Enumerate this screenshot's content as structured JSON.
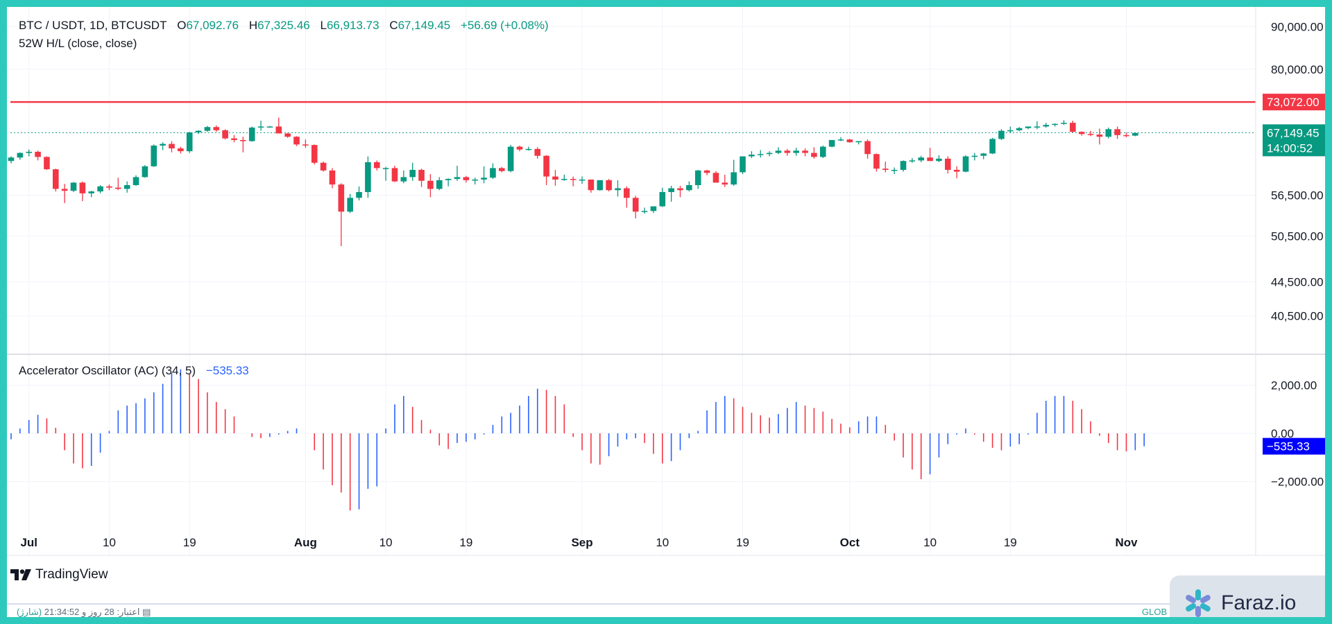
{
  "legend": {
    "symbol": "BTC / USDT, 1D, BTCUSDT",
    "o_label": "O",
    "o_value": "67,092.76",
    "h_label": "H",
    "h_value": "67,325.46",
    "l_label": "L",
    "l_value": "66,913.73",
    "c_label": "C",
    "c_value": "67,149.45",
    "change": "+56.69 (+0.08%)",
    "indicator": "52W H/L (close, close)",
    "oscillator": "Accelerator Oscillator (AC) (34, 5)",
    "oscillator_value": "−535.33"
  },
  "price_axis": {
    "ticks": [
      {
        "value": 90000,
        "label": "90,000.00"
      },
      {
        "value": 80000,
        "label": "80,000.00"
      },
      {
        "value": 56500,
        "label": "56,500.00"
      },
      {
        "value": 50500,
        "label": "50,500.00"
      },
      {
        "value": 44500,
        "label": "44,500.00"
      },
      {
        "value": 40500,
        "label": "40,500.00"
      }
    ],
    "high_line": {
      "value": 73072,
      "label": "73,072.00",
      "color": "#f23645"
    },
    "last_price": {
      "value": 67149.45,
      "label": "67,149.45",
      "countdown": "14:00:52",
      "color": "#089981"
    }
  },
  "osc_axis": {
    "ticks": [
      {
        "value": 2000,
        "label": "2,000.00"
      },
      {
        "value": 0,
        "label": "0.00"
      },
      {
        "value": -2000,
        "label": "−2,000.00"
      }
    ],
    "last": {
      "value": -535.33,
      "label": "−535.33",
      "color": "#0000ff"
    }
  },
  "time_axis": [
    {
      "label": "Jul",
      "bold": true,
      "index": 2
    },
    {
      "label": "10",
      "bold": false,
      "index": 11
    },
    {
      "label": "19",
      "bold": false,
      "index": 20
    },
    {
      "label": "Aug",
      "bold": true,
      "index": 33
    },
    {
      "label": "10",
      "bold": false,
      "index": 42
    },
    {
      "label": "19",
      "bold": false,
      "index": 51
    },
    {
      "label": "Sep",
      "bold": true,
      "index": 64
    },
    {
      "label": "10",
      "bold": false,
      "index": 73
    },
    {
      "label": "19",
      "bold": false,
      "index": 82
    },
    {
      "label": "Oct",
      "bold": true,
      "index": 94
    },
    {
      "label": "10",
      "bold": false,
      "index": 103
    },
    {
      "label": "19",
      "bold": false,
      "index": 112
    },
    {
      "label": "Nov",
      "bold": true,
      "index": 125
    }
  ],
  "brand": {
    "name": "TradingView",
    "icon": "tradingview-logo-icon"
  },
  "status": {
    "text": "اعتبار: 28 روز و 21:34:52",
    "accent": "(شارژ)",
    "right": "GLOB"
  },
  "watermark": {
    "text": "Faraz.io",
    "icon": "faraz-logo-icon"
  },
  "colors": {
    "up": "#089981",
    "down": "#f23645",
    "osc_up": "#2962ff",
    "osc_down": "#f23645",
    "grid": "#f0f3fa"
  },
  "chart_data": {
    "type": "candlestick",
    "title": "BTC / USDT, 1D, BTCUSDT",
    "interval": "1D",
    "y_scale": "log",
    "price_range": [
      36500,
      95000
    ],
    "first_date": "2024-06-29",
    "candles": [
      [
        62100,
        62900,
        61700,
        62700
      ],
      [
        62700,
        63600,
        62300,
        63500
      ],
      [
        63500,
        64100,
        62900,
        63700
      ],
      [
        63700,
        63900,
        62200,
        62800
      ],
      [
        62800,
        62900,
        60600,
        60700
      ],
      [
        60700,
        60800,
        57100,
        57500
      ],
      [
        57500,
        58300,
        55300,
        57200
      ],
      [
        57200,
        58600,
        57000,
        58500
      ],
      [
        58500,
        58700,
        55600,
        56800
      ],
      [
        56800,
        57200,
        56200,
        57100
      ],
      [
        57100,
        58100,
        56800,
        57900
      ],
      [
        57900,
        58200,
        57300,
        57700
      ],
      [
        57700,
        59300,
        57300,
        57500
      ],
      [
        57500,
        58700,
        56900,
        58100
      ],
      [
        58100,
        59700,
        58000,
        59400
      ],
      [
        59400,
        61400,
        59300,
        61200
      ],
      [
        61200,
        65000,
        61100,
        64800
      ],
      [
        64800,
        65400,
        64000,
        65100
      ],
      [
        65100,
        65600,
        63600,
        64300
      ],
      [
        64300,
        64600,
        63400,
        63800
      ],
      [
        63800,
        67300,
        63500,
        67200
      ],
      [
        67200,
        67600,
        66900,
        67500
      ],
      [
        67500,
        68400,
        67300,
        68200
      ],
      [
        68200,
        68500,
        67300,
        67600
      ],
      [
        67600,
        67800,
        65900,
        66100
      ],
      [
        66100,
        66700,
        65400,
        65800
      ],
      [
        65800,
        66400,
        63600,
        65600
      ],
      [
        65600,
        68300,
        65500,
        68100
      ],
      [
        68100,
        69400,
        67500,
        68300
      ],
      [
        68300,
        68400,
        68100,
        68300
      ],
      [
        68300,
        70000,
        67000,
        67000
      ],
      [
        67000,
        67100,
        66200,
        66400
      ],
      [
        66400,
        66500,
        64700,
        65000
      ],
      [
        65000,
        65900,
        64400,
        64900
      ],
      [
        64900,
        65000,
        61500,
        61800
      ],
      [
        61800,
        62000,
        60300,
        60500
      ],
      [
        60500,
        60900,
        57600,
        58200
      ],
      [
        58200,
        58400,
        49100,
        54000
      ],
      [
        54000,
        56700,
        53800,
        56100
      ],
      [
        56100,
        57900,
        55700,
        57000
      ],
      [
        57000,
        62900,
        56100,
        61900
      ],
      [
        61900,
        62200,
        60500,
        60900
      ],
      [
        60900,
        61100,
        58800,
        60900
      ],
      [
        60900,
        61300,
        58600,
        58700
      ],
      [
        58700,
        60500,
        58400,
        59400
      ],
      [
        59400,
        61800,
        58800,
        60600
      ],
      [
        60600,
        60800,
        57800,
        58800
      ],
      [
        58800,
        59900,
        56200,
        57500
      ],
      [
        57500,
        59400,
        57300,
        58900
      ],
      [
        58900,
        59200,
        57900,
        59100
      ],
      [
        59100,
        61300,
        58800,
        59400
      ],
      [
        59400,
        59600,
        58500,
        58900
      ],
      [
        58900,
        59300,
        58200,
        59000
      ],
      [
        59000,
        61200,
        58400,
        59300
      ],
      [
        59300,
        61700,
        59100,
        60900
      ],
      [
        60900,
        61100,
        60200,
        60400
      ],
      [
        60400,
        64900,
        60200,
        64600
      ],
      [
        64600,
        64800,
        63800,
        64100
      ],
      [
        64100,
        64600,
        63900,
        64200
      ],
      [
        64200,
        64500,
        62500,
        63000
      ],
      [
        63000,
        63100,
        58100,
        59500
      ],
      [
        59500,
        60600,
        58000,
        59000
      ],
      [
        59000,
        59800,
        58800,
        59100
      ],
      [
        59100,
        59500,
        57900,
        59000
      ],
      [
        59000,
        59500,
        58300,
        59000
      ],
      [
        59000,
        59000,
        56900,
        57300
      ],
      [
        57300,
        58900,
        57200,
        58900
      ],
      [
        58900,
        59100,
        57100,
        57300
      ],
      [
        57300,
        58900,
        56300,
        57600
      ],
      [
        57600,
        57900,
        54600,
        56100
      ],
      [
        56100,
        56400,
        53000,
        54000
      ],
      [
        54000,
        54600,
        53700,
        54100
      ],
      [
        54100,
        54600,
        53800,
        54800
      ],
      [
        54800,
        57700,
        54700,
        57000
      ],
      [
        57000,
        58000,
        55500,
        57600
      ],
      [
        57600,
        58000,
        56200,
        57300
      ],
      [
        57300,
        58700,
        57100,
        58100
      ],
      [
        58100,
        60600,
        57500,
        60500
      ],
      [
        60500,
        60600,
        59700,
        60100
      ],
      [
        60100,
        60400,
        58600,
        58500
      ],
      [
        58500,
        59800,
        57800,
        58200
      ],
      [
        58200,
        62300,
        58000,
        60200
      ],
      [
        60200,
        62500,
        59900,
        62900
      ],
      [
        62900,
        63800,
        62600,
        63200
      ],
      [
        63200,
        64000,
        62700,
        63300
      ],
      [
        63300,
        63800,
        62900,
        63500
      ],
      [
        63500,
        64500,
        63300,
        63900
      ],
      [
        63900,
        64200,
        63000,
        63500
      ],
      [
        63500,
        64400,
        63000,
        63900
      ],
      [
        63900,
        64300,
        62900,
        63500
      ],
      [
        63500,
        64500,
        62500,
        62800
      ],
      [
        62800,
        64800,
        62600,
        64600
      ],
      [
        64600,
        65800,
        64500,
        65800
      ],
      [
        65800,
        66300,
        65600,
        65900
      ],
      [
        65900,
        66000,
        65300,
        65400
      ],
      [
        65400,
        65500,
        65000,
        65600
      ],
      [
        65600,
        65900,
        62500,
        63300
      ],
      [
        63300,
        63400,
        60300,
        60800
      ],
      [
        60800,
        62000,
        60200,
        60600
      ],
      [
        60600,
        61000,
        59900,
        60600
      ],
      [
        60600,
        62200,
        60300,
        62100
      ],
      [
        62100,
        62600,
        61800,
        62200
      ],
      [
        62200,
        63000,
        61900,
        62700
      ],
      [
        62700,
        64400,
        62100,
        62100
      ],
      [
        62100,
        63100,
        61900,
        62500
      ],
      [
        62500,
        62900,
        60000,
        60600
      ],
      [
        60600,
        61200,
        59200,
        60300
      ],
      [
        60300,
        63100,
        60200,
        62900
      ],
      [
        62900,
        63500,
        62200,
        63000
      ],
      [
        63000,
        63500,
        62400,
        63400
      ],
      [
        63400,
        66200,
        63300,
        66000
      ],
      [
        66000,
        67800,
        65800,
        67500
      ],
      [
        67500,
        68300,
        67100,
        67600
      ],
      [
        67600,
        68200,
        67400,
        68000
      ],
      [
        68000,
        68200,
        67800,
        68300
      ],
      [
        68300,
        69300,
        67800,
        68300
      ],
      [
        68300,
        69000,
        68100,
        68600
      ],
      [
        68600,
        68900,
        68300,
        68800
      ],
      [
        68800,
        69500,
        68600,
        69000
      ],
      [
        69000,
        69400,
        67200,
        67300
      ],
      [
        67300,
        67400,
        66600,
        66900
      ],
      [
        66900,
        67500,
        66500,
        66800
      ],
      [
        66800,
        67900,
        65000,
        66400
      ],
      [
        66400,
        68100,
        66100,
        67800
      ],
      [
        67800,
        68300,
        66000,
        66700
      ],
      [
        66700,
        67200,
        66300,
        66600
      ],
      [
        66600,
        67200,
        66500,
        67092
      ]
    ],
    "oscillator": {
      "name": "Accelerator Oscillator (AC) (34, 5)",
      "values": [
        -250,
        200,
        550,
        770,
        620,
        230,
        -700,
        -1250,
        -1450,
        -1350,
        -800,
        100,
        950,
        1150,
        1250,
        1450,
        1700,
        2050,
        2500,
        2650,
        2450,
        2250,
        1700,
        1300,
        1000,
        700,
        0,
        -150,
        -200,
        -150,
        -50,
        100,
        200,
        0,
        -700,
        -1500,
        -2150,
        -2450,
        -3200,
        -3150,
        -2300,
        -2200,
        200,
        1200,
        1550,
        1100,
        550,
        150,
        -500,
        -650,
        -400,
        -350,
        -250,
        -50,
        350,
        700,
        850,
        1150,
        1550,
        1850,
        1800,
        1550,
        1200,
        -150,
        -700,
        -1250,
        -1300,
        -950,
        -550,
        -250,
        -200,
        -400,
        -850,
        -1250,
        -1150,
        -700,
        -200,
        100,
        950,
        1300,
        1550,
        1450,
        1100,
        850,
        750,
        650,
        800,
        1050,
        1300,
        1150,
        1050,
        900,
        600,
        400,
        250,
        500,
        700,
        700,
        350,
        -300,
        -1000,
        -1500,
        -1900,
        -1700,
        -1000,
        -450,
        -50,
        200,
        -50,
        -350,
        -600,
        -700,
        -550,
        -450,
        -50,
        850,
        1350,
        1550,
        1550,
        1350,
        1000,
        500,
        -100,
        -400,
        -700,
        -750,
        -700,
        -535.33
      ]
    }
  }
}
